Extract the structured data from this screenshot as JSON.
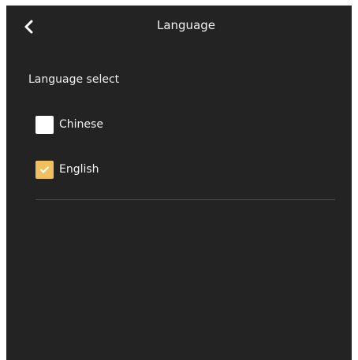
{
  "header": {
    "back_icon": "chevron-left-icon",
    "title": "Language"
  },
  "section": {
    "label": "Language select"
  },
  "options": [
    {
      "label": "Chinese",
      "checked": false
    },
    {
      "label": "English",
      "checked": true
    }
  ],
  "colors": {
    "background": "#232323",
    "accent": "#f0c060",
    "text": "#f2f2f2",
    "divider": "#4a4a4a"
  }
}
